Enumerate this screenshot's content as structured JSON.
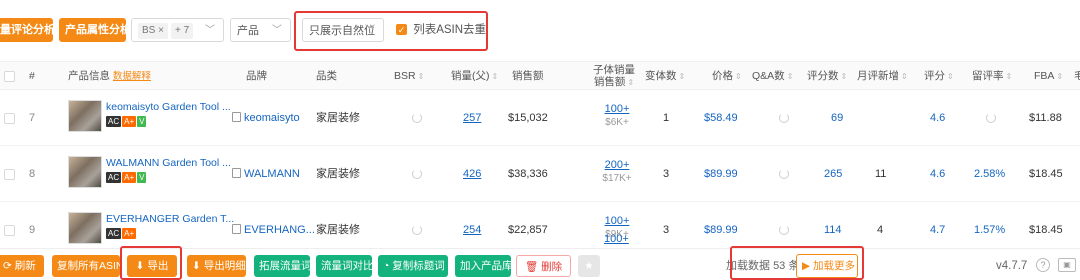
{
  "toolbar": {
    "review_analysis": "量评论分析",
    "attribute_analysis": "产品属性分析",
    "bs_tag": "BS",
    "bs_more": "+ 7",
    "product_select": "产品",
    "natural_select": "只展示自然位",
    "asin_dedupe_label": "列表ASIN去重"
  },
  "headers": {
    "index": "#",
    "product_info": "产品信息",
    "data_explain": "数据解释",
    "brand": "品牌",
    "category": "品类",
    "bsr": "BSR",
    "sales_parent": "销量(父)",
    "revenue": "销售额",
    "child_sales_1": "子体销量",
    "child_sales_2": "销售额",
    "variants": "变体数",
    "price": "价格",
    "qa": "Q&A数",
    "reviews": "评分数",
    "monthly_new": "月评新增",
    "rating": "评分",
    "retention": "留评率",
    "fba": "FBA",
    "last": "毛"
  },
  "rows": [
    {
      "index": "7",
      "name": "keomaisyto Garden Tool ...",
      "badges": [
        "AC",
        "A+",
        "V"
      ],
      "brand": "keomaisyto",
      "category": "家居装修",
      "sales": "257",
      "revenue": "$15,032",
      "child_sales": "100+",
      "child_revenue": "$6K+",
      "variants": "1",
      "price": "$58.49",
      "reviews": "69",
      "monthly_new": "",
      "rating": "4.6",
      "retention": "",
      "fba": "$11.88"
    },
    {
      "index": "8",
      "name": "WALMANN Garden Tool ...",
      "badges": [
        "AC",
        "A+",
        "V"
      ],
      "brand": "WALMANN",
      "category": "家居装修",
      "sales": "426",
      "revenue": "$38,336",
      "child_sales": "200+",
      "child_revenue": "$17K+",
      "variants": "3",
      "price": "$89.99",
      "reviews": "265",
      "monthly_new": "11",
      "rating": "4.6",
      "retention": "2.58%",
      "fba": "$18.45"
    },
    {
      "index": "9",
      "name": "EVERHANGER Garden T...",
      "badges": [
        "AC",
        "A+"
      ],
      "brand": "EVERHANG...",
      "category": "家居装修",
      "sales": "254",
      "revenue": "$22,857",
      "child_sales": "100+",
      "child_revenue": "$9K+",
      "variants": "3",
      "price": "$89.99",
      "reviews": "114",
      "monthly_new": "4",
      "rating": "4.7",
      "retention": "1.57%",
      "fba": "$18.45"
    }
  ],
  "partial_row": {
    "child_sales": "100+"
  },
  "bottom": {
    "refresh": "刷新",
    "copy_asin": "复制所有ASIN",
    "export": "导出",
    "export_detail": "导出明细",
    "expand_keywords": "拓展流量词",
    "compare_keywords": "流量词对比",
    "copy_title_words": "复制标题词",
    "add_to_library": "加入产品库",
    "delete": "删除",
    "loaded_prefix": "加载数据",
    "loaded_count": "53",
    "loaded_suffix": "条",
    "load_more": "加载更多",
    "version": "v4.7.7"
  },
  "colors": {
    "accent": "#f48a15",
    "green": "#14b37d",
    "link": "#1565c0",
    "highlight": "#e53935"
  }
}
